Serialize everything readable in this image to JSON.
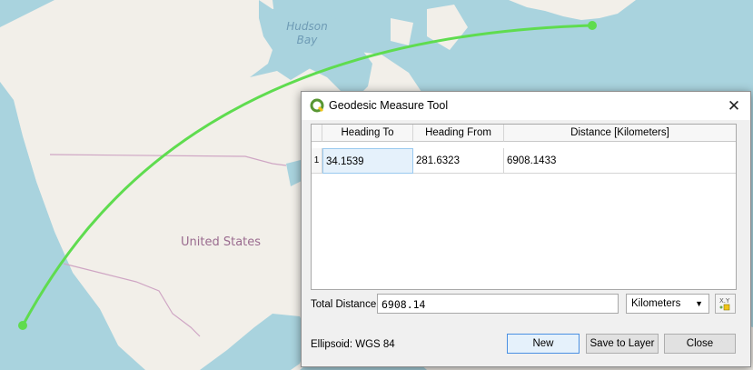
{
  "map": {
    "labels": {
      "hudson_bay": "Hudson\nBay",
      "country": "United States"
    },
    "colors": {
      "water": "#a9d3de",
      "land": "#f2efe9",
      "geodesic_line": "#5fdc4f"
    }
  },
  "dialog": {
    "title": "Geodesic Measure Tool",
    "close_icon": "close-icon",
    "table": {
      "columns": [
        "Heading To",
        "Heading From",
        "Distance [Kilometers]"
      ],
      "rows": [
        {
          "index": "1",
          "heading_to": "34.1539",
          "heading_from": "281.6323",
          "distance": "6908.1433"
        }
      ]
    },
    "total_distance": {
      "label": "Total Distance",
      "value": "6908.14"
    },
    "units": {
      "selected": "Kilometers"
    },
    "ellipsoid": "Ellipsoid: WGS 84",
    "buttons": {
      "new": "New",
      "save": "Save to Layer",
      "close": "Close"
    }
  }
}
